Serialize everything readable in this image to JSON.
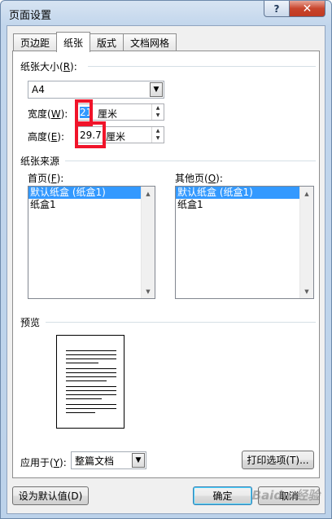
{
  "window": {
    "title": "页面设置",
    "help_label": "?",
    "close_label": "✕"
  },
  "tabs": [
    {
      "label": "页边距",
      "active": false
    },
    {
      "label": "纸张",
      "active": true
    },
    {
      "label": "版式",
      "active": false
    },
    {
      "label": "文档网格",
      "active": false
    }
  ],
  "paper_size": {
    "label": "纸张大小(",
    "mnemonic": "R",
    "label_end": "):",
    "value": "A4",
    "width_label": "宽度(",
    "width_mnemonic": "W",
    "width_label_end": "):",
    "width_value": "21",
    "height_label": "高度(",
    "height_mnemonic": "E",
    "height_label_end": "):",
    "height_value": "29.7",
    "unit": "厘米"
  },
  "paper_source": {
    "label": "纸张来源",
    "first_page_label": "首页(",
    "first_page_mnemonic": "F",
    "first_page_label_end": "):",
    "other_pages_label": "其他页(",
    "other_pages_mnemonic": "O",
    "other_pages_label_end": "):",
    "first_page_items": [
      "默认纸盒 (纸盒1)",
      "纸盒1"
    ],
    "other_pages_items": [
      "默认纸盒 (纸盒1)",
      "纸盒1"
    ]
  },
  "preview": {
    "label": "预览",
    "apply_to_label": "应用于(",
    "apply_to_mnemonic": "Y",
    "apply_to_label_end": "):",
    "apply_to_value": "整篇文档",
    "print_options_label": "打印选项(T)..."
  },
  "footer": {
    "set_default_label": "设为默认值(D)",
    "ok_label": "确定",
    "cancel_label": "取消"
  },
  "watermark": "Baidu 经验",
  "colors": {
    "selection": "#3399ff",
    "highlight_box": "#f0142a",
    "close_button": "#c8452d"
  }
}
